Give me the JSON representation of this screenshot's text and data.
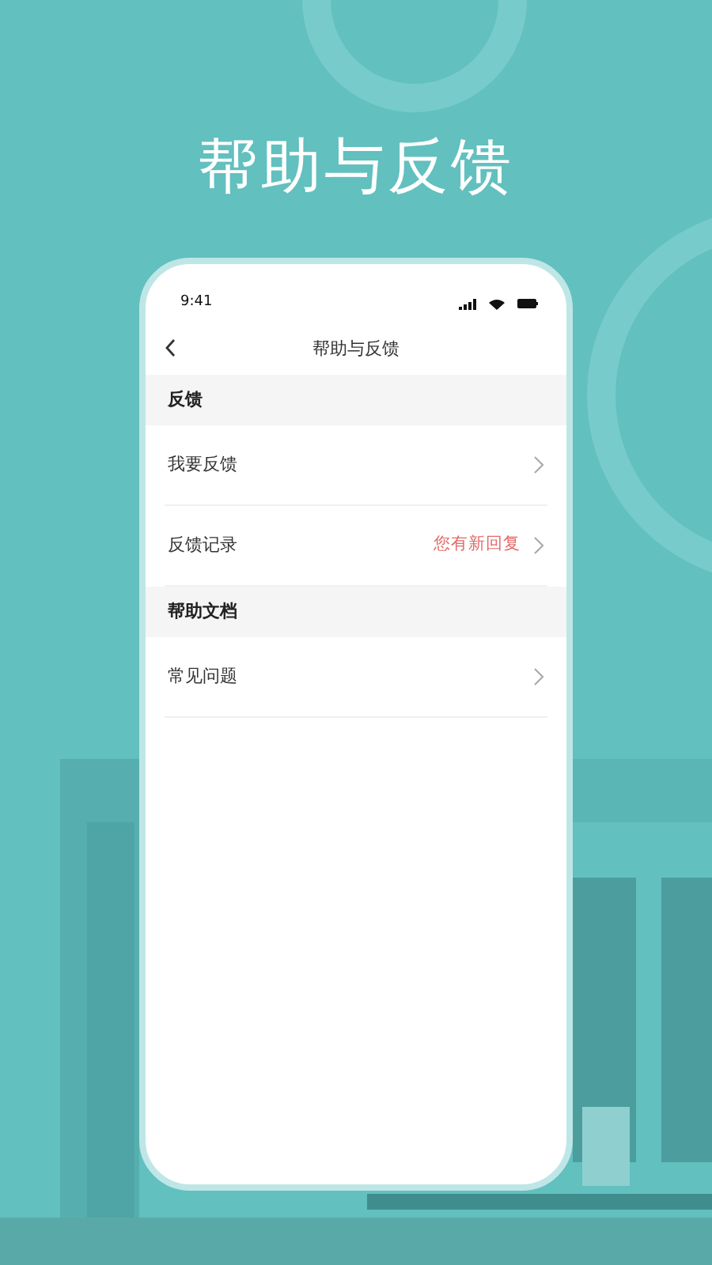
{
  "headline": "帮助与反馈",
  "phone": {
    "status_time": "9:41",
    "nav_title": "帮助与反馈",
    "sections": [
      {
        "title": "反馈",
        "items": [
          {
            "label": "我要反馈"
          },
          {
            "label": "反馈记录",
            "note": "您有新回复"
          }
        ]
      },
      {
        "title": "帮助文档",
        "items": [
          {
            "label": "常见问题"
          }
        ]
      }
    ]
  }
}
